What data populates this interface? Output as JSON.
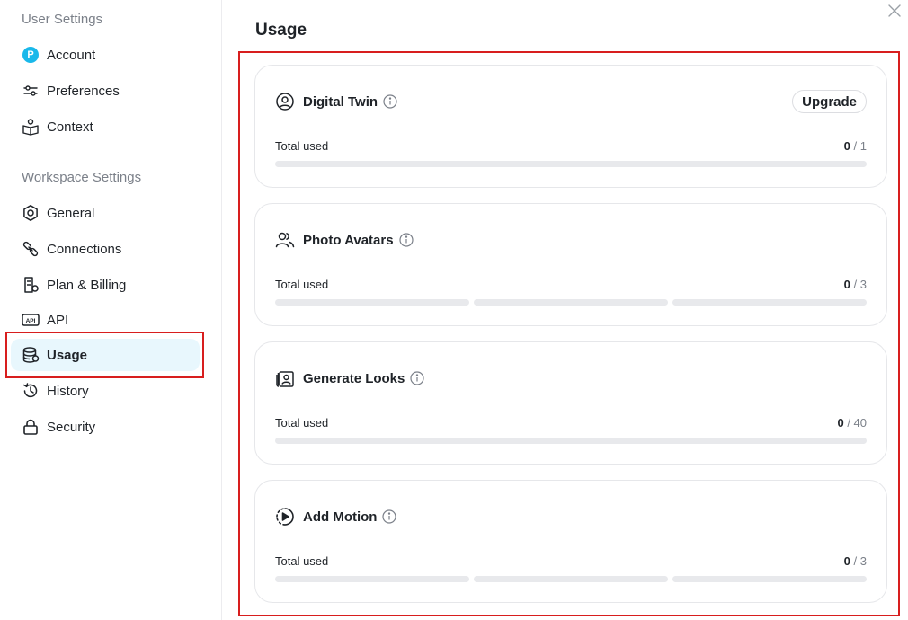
{
  "sidebar": {
    "user_settings_title": "User Settings",
    "workspace_settings_title": "Workspace Settings",
    "account": {
      "label": "Account",
      "avatar_letter": "P"
    },
    "preferences": {
      "label": "Preferences"
    },
    "context": {
      "label": "Context"
    },
    "general": {
      "label": "General"
    },
    "connections": {
      "label": "Connections"
    },
    "plan_billing": {
      "label": "Plan & Billing"
    },
    "api": {
      "label": "API",
      "icon_text": "API"
    },
    "usage": {
      "label": "Usage",
      "active": true
    },
    "history": {
      "label": "History"
    },
    "security": {
      "label": "Security"
    }
  },
  "main": {
    "title": "Usage",
    "cards": [
      {
        "title": "Digital Twin",
        "icon": "user-circle-icon",
        "upgrade_label": "Upgrade",
        "total_label": "Total used",
        "used": "0",
        "limit": "/ 1",
        "used_value": 0,
        "limit_value": 1,
        "segments": 1
      },
      {
        "title": "Photo Avatars",
        "icon": "users-icon",
        "total_label": "Total used",
        "used": "0",
        "limit": "/ 3",
        "used_value": 0,
        "limit_value": 3,
        "segments": 3
      },
      {
        "title": "Generate Looks",
        "icon": "photo-portrait-icon",
        "total_label": "Total used",
        "used": "0",
        "limit": "/ 40",
        "used_value": 0,
        "limit_value": 40,
        "segments": 1
      },
      {
        "title": "Add Motion",
        "icon": "motion-play-icon",
        "total_label": "Total used",
        "used": "0",
        "limit": "/ 3",
        "used_value": 0,
        "limit_value": 3,
        "segments": 3
      }
    ]
  },
  "colors": {
    "accent": "#19b8ea",
    "active_bg": "#e8f7fd",
    "highlight": "#d81e1e",
    "bar_empty": "#e8e9ec"
  }
}
